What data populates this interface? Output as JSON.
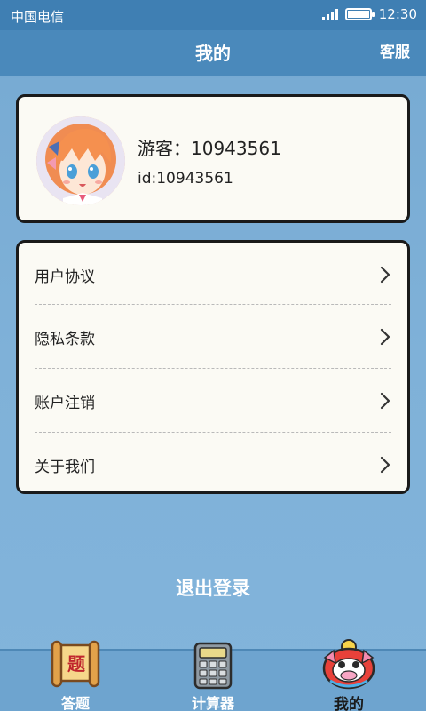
{
  "status_bar": {
    "carrier": "中国电信",
    "time": "12:30",
    "signal_icon": "signal-icon",
    "battery_icon": "battery-icon"
  },
  "header": {
    "title": "我的",
    "service_label": "客服"
  },
  "profile": {
    "name": "游客：10943561",
    "id_text": "id:10943561",
    "avatar_icon": "avatar-anime-girl"
  },
  "menu": {
    "items": [
      {
        "label": "用户协议",
        "icon": "chevron-right-icon"
      },
      {
        "label": "隐私条款",
        "icon": "chevron-right-icon"
      },
      {
        "label": "账户注销",
        "icon": "chevron-right-icon"
      },
      {
        "label": "关于我们",
        "icon": "chevron-right-icon"
      }
    ]
  },
  "logout_label": "退出登录",
  "bottom_nav": {
    "items": [
      {
        "label": "答题",
        "icon": "scroll-quiz-icon",
        "icon_text": "题",
        "active": false
      },
      {
        "label": "计算器",
        "icon": "calculator-icon",
        "active": false
      },
      {
        "label": "我的",
        "icon": "lion-mascot-icon",
        "active": true
      }
    ]
  },
  "colors": {
    "header_bg": "#4a89bb",
    "status_bg": "#3f7fb3",
    "page_bg": "#7fb1d8",
    "card_bg": "#fbfaf4",
    "card_border": "#1a1a1a",
    "nav_bg": "#6ea4cf"
  }
}
